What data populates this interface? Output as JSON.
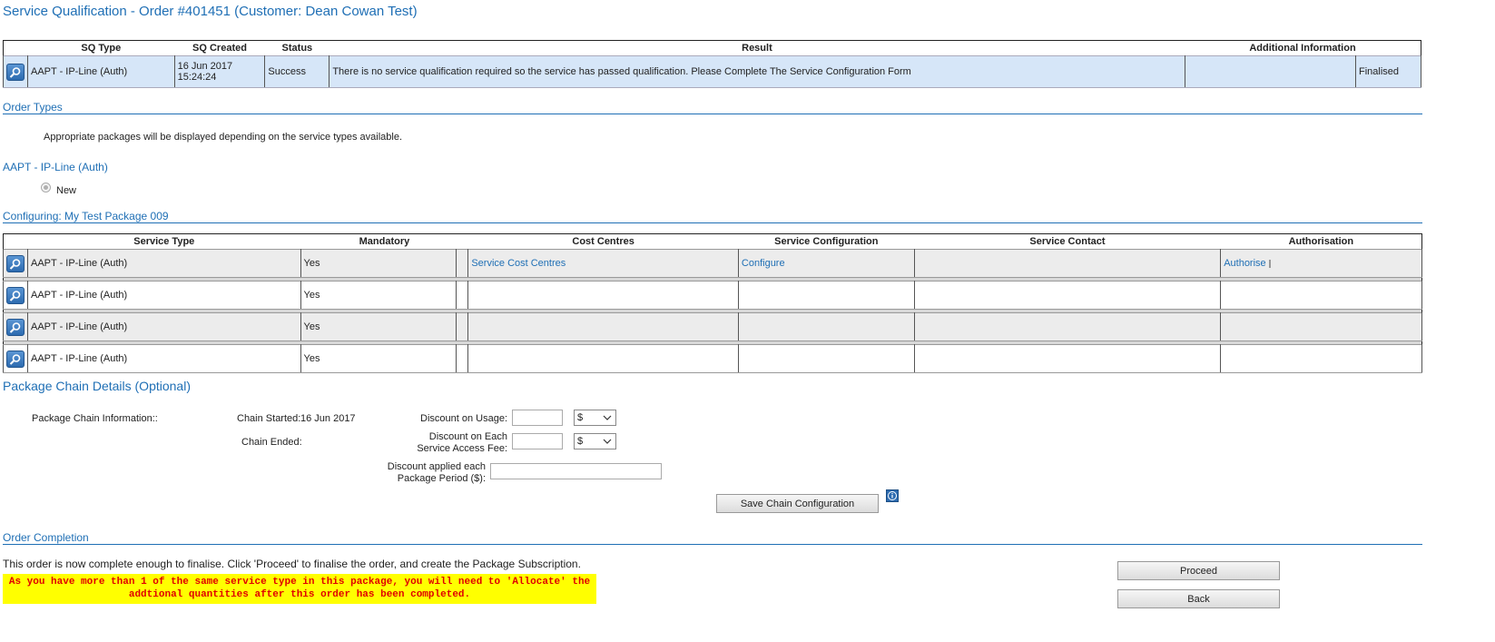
{
  "page": {
    "title": "Service Qualification - Order #401451 (Customer: Dean Cowan Test)"
  },
  "sq_table": {
    "headers": [
      "SQ Type",
      "SQ Created",
      "Status",
      "Result",
      "Additional Information"
    ],
    "row": {
      "type": "AAPT - IP-Line (Auth)",
      "created_date": "16 Jun 2017",
      "created_time": "15:24:24",
      "status": "Success",
      "result": "There is no service qualification required so the service has passed qualification. Please Complete The Service Configuration Form",
      "additional_info": "",
      "finalised": "Finalised"
    }
  },
  "order_types": {
    "title": "Order Types",
    "info": "Appropriate packages will be displayed depending on the service types available.",
    "service_type": "AAPT - IP-Line (Auth)",
    "option_label": "New"
  },
  "configuring": {
    "title": "Configuring: My Test Package 009",
    "headers": [
      "Service Type",
      "Mandatory",
      "Cost Centres",
      "Service Configuration",
      "Service Contact",
      "Authorisation"
    ],
    "rows": [
      {
        "service_type": "AAPT - IP-Line (Auth)",
        "mandatory": "Yes",
        "cost_centres": "Service Cost Centres",
        "service_config": "Configure",
        "contact": "",
        "authorisation": "Authorise"
      },
      {
        "service_type": "AAPT - IP-Line (Auth)",
        "mandatory": "Yes",
        "cost_centres": "",
        "service_config": "",
        "contact": "",
        "authorisation": ""
      },
      {
        "service_type": "AAPT - IP-Line (Auth)",
        "mandatory": "Yes",
        "cost_centres": "",
        "service_config": "",
        "contact": "",
        "authorisation": ""
      },
      {
        "service_type": "AAPT - IP-Line (Auth)",
        "mandatory": "Yes",
        "cost_centres": "",
        "service_config": "",
        "contact": "",
        "authorisation": ""
      }
    ]
  },
  "package_chain": {
    "title": "Package Chain Details (Optional)",
    "info_label": "Package Chain Information::",
    "chain_started_label": "Chain Started:",
    "chain_started_value": "16 Jun 2017",
    "chain_ended_label": "Chain Ended:",
    "discount_usage_label": "Discount on Usage:",
    "discount_usage_value": "",
    "discount_usage_unit": "$",
    "discount_access_label_1": "Discount on Each",
    "discount_access_label_2": "Service Access Fee:",
    "discount_access_value": "",
    "discount_access_unit": "$",
    "discount_period_label_1": "Discount applied each",
    "discount_period_label_2": "Package Period ($):",
    "discount_period_value": "",
    "save_button": "Save Chain Configuration"
  },
  "order_completion": {
    "title": "Order Completion",
    "message": "This order is now complete enough to finalise. Click 'Proceed' to finalise the order, and create the Package Subscription.",
    "warning_line_1": "As you have more than 1 of the same service type in this package, you will need to 'Allocate' the",
    "warning_line_2": "addtional quantities after this order has been completed.",
    "proceed_button": "Proceed",
    "back_button": "Back"
  },
  "colors": {
    "accent": "#1f6fb5",
    "sq_row_bg": "#d6e6f8",
    "warning_bg": "#ffff00",
    "warning_text": "#e00000"
  }
}
